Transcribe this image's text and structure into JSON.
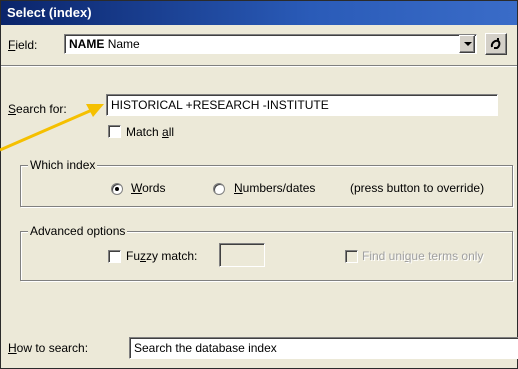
{
  "window": {
    "title": "Select (index)"
  },
  "field": {
    "label_prefix": "",
    "label_underlined": "F",
    "label_rest": "ield:",
    "code": "NAME",
    "value": "Name"
  },
  "search": {
    "label_underlined": "S",
    "label_rest": "earch for:",
    "value": "HISTORICAL +RESEARCH -INSTITUTE"
  },
  "match_all": {
    "label_prefix": "Match ",
    "label_underlined": "a",
    "label_rest": "ll",
    "checked": false
  },
  "which_index": {
    "title": "Which index",
    "words": {
      "label_underlined": "W",
      "label_rest": "ords",
      "selected": true
    },
    "numbers": {
      "label_underlined": "N",
      "label_rest": "umbers/dates",
      "selected": false
    },
    "hint": "(press button to override)"
  },
  "advanced": {
    "title": "Advanced options",
    "fuzzy": {
      "label_prefix": "Fu",
      "label_underlined": "z",
      "label_rest": "zy match:",
      "value": ""
    },
    "unique": {
      "label_prefix": "Find uni",
      "label_underlined": "q",
      "label_rest": "ue terms only"
    }
  },
  "how": {
    "label_underlined": "H",
    "label_rest": "ow to search:",
    "value": "Search the database index"
  },
  "colors": {
    "title_bar": "#0a246a",
    "annotation_arrow": "#f5c000"
  }
}
